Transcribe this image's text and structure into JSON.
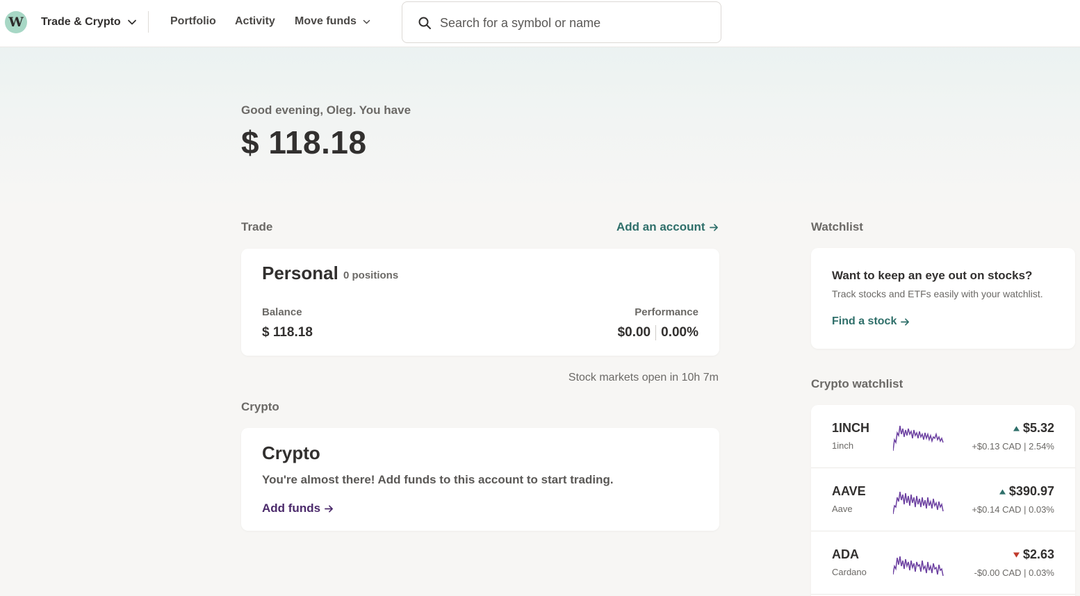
{
  "nav": {
    "logo_letter": "W",
    "account_switcher": "Trade & Crypto",
    "links": [
      "Portfolio",
      "Activity",
      "Move funds"
    ]
  },
  "search": {
    "placeholder": "Search for a symbol or name",
    "value": ""
  },
  "summary": {
    "greeting": "Good evening, Oleg. You have",
    "total": "$ 118.18"
  },
  "trade": {
    "heading": "Trade",
    "add_account": "Add an account",
    "account": {
      "name": "Personal",
      "positions": "0 positions",
      "balance_label": "Balance",
      "balance": "$ 118.18",
      "performance_label": "Performance",
      "performance_amount": "$0.00",
      "performance_percent": "0.00%"
    },
    "market_status": "Stock markets open in 10h 7m"
  },
  "crypto": {
    "heading": "Crypto",
    "card_title": "Crypto",
    "message": "You're almost there! Add funds to this account to start trading.",
    "add_funds": "Add funds"
  },
  "watchlist": {
    "heading": "Watchlist",
    "empty_title": "Want to keep an eye out on stocks?",
    "empty_sub": "Track stocks and ETFs easily with your watchlist.",
    "find_stock": "Find a stock"
  },
  "crypto_watchlist": {
    "heading": "Crypto watchlist",
    "items": [
      {
        "symbol": "1INCH",
        "name": "1inch",
        "price": "$5.32",
        "direction": "up",
        "change": "+$0.13 CAD | 2.54%"
      },
      {
        "symbol": "AAVE",
        "name": "Aave",
        "price": "$390.97",
        "direction": "up",
        "change": "+$0.14 CAD | 0.03%"
      },
      {
        "symbol": "ADA",
        "name": "Cardano",
        "price": "$2.63",
        "direction": "down",
        "change": "-$0.00 CAD | 0.03%"
      }
    ]
  },
  "colors": {
    "accent_teal": "#2f6f6a",
    "accent_purple": "#4b2a6b",
    "sparkline": "#6b3fa0",
    "up": "#2f6f6a",
    "down": "#c0392b",
    "logo_bg": "#a7d7c5"
  }
}
